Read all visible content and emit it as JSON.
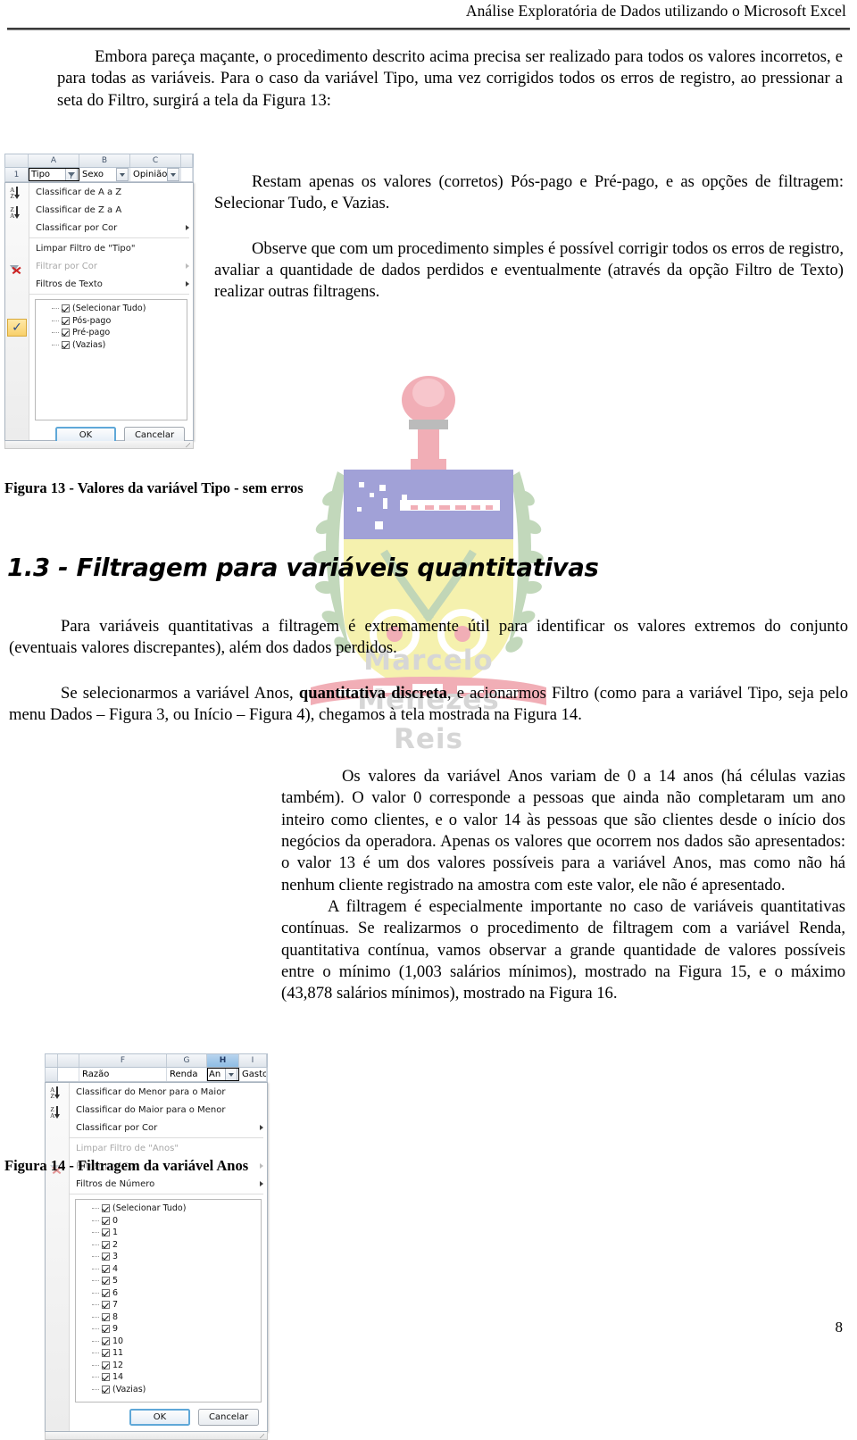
{
  "header": {
    "title": "Análise Exploratória de Dados utilizando o Microsoft Excel"
  },
  "watermark": {
    "name_line1": "Marcelo",
    "name_line2": "Menezes",
    "name_line3": "Reis",
    "colors": {
      "shield_top": "#9a9ad4",
      "shield_bottom": "#f5f0a8",
      "torch": "#f0a8b0",
      "laurel": "#a8c8a0",
      "text": "#d6d6d6"
    }
  },
  "paragraphs": {
    "p1": "Embora pareça maçante, o procedimento descrito acima precisa ser realizado para todos os valores incorretos, e para todas as variáveis. Para o caso da variável Tipo, uma vez corrigidos todos os erros de registro, ao pressionar a seta do Filtro, surgirá a tela da Figura 13:",
    "p2": "Restam apenas os valores (corretos) Pós-pago e Pré-pago, e as opções de filtragem: Selecionar Tudo, e Vazias.",
    "p3": "Observe que com um procedimento simples é possível corrigir todos os erros de registro, avaliar a quantidade de dados perdidos e eventualmente (através da opção Filtro de Texto) realizar outras filtragens.",
    "p4": "Para variáveis quantitativas a filtragem é extremamente útil para identificar os valores extremos do conjunto (eventuais valores discrepantes), além dos dados perdidos.",
    "p5_a": "Se selecionarmos a variável Anos, ",
    "p5_b": "quantitativa discreta",
    "p5_c": ", e acionarmos Filtro (como para a variável Tipo, seja pelo menu Dados – Figura 3, ou Início – Figura 4), chegamos à tela mostrada na Figura 14.",
    "p6": "Os valores da variável Anos variam de 0 a 14 anos (há células vazias também). O valor 0 corresponde a pessoas que ainda não completaram um ano inteiro como clientes, e o valor 14 às pessoas que são clientes desde o início dos negócios da operadora. Apenas os valores que ocorrem nos dados são apresentados: o valor 13 é um dos valores possíveis para a variável Anos, mas como não há nenhum cliente registrado na amostra com este valor, ele não é apresentado.",
    "p7": "A filtragem é especialmente importante no caso de variáveis quantitativas contínuas. Se realizarmos o procedimento de filtragem com a variável Renda, quantitativa contínua, vamos observar a grande quantidade de valores possíveis entre o mínimo (1,003 salários mínimos), mostrado na Figura 15, e o máximo (43,878 salários mínimos), mostrado na Figura 16."
  },
  "section_heading": "1.3 - Filtragem para variáveis quantitativas",
  "captions": {
    "figura13": "Figura 13 - Valores da variável Tipo - sem erros",
    "figura14": "Figura 14 - Filtragem da variável Anos"
  },
  "figura13_dialog": {
    "columns": [
      "A",
      "B",
      "C"
    ],
    "row_number": "1",
    "cells": [
      "Tipo",
      "Sexo",
      "Opinião"
    ],
    "menu_items": [
      {
        "label": "Classificar de A a Z",
        "dim": false,
        "submenu": false
      },
      {
        "label": "Classificar de Z a A",
        "dim": false,
        "submenu": false
      },
      {
        "label": "Classificar por Cor",
        "dim": false,
        "submenu": true
      },
      {
        "label": "Limpar Filtro de \"Tipo\"",
        "dim": false,
        "submenu": false
      },
      {
        "label": "Filtrar por Cor",
        "dim": true,
        "submenu": true
      },
      {
        "label": "Filtros de Texto",
        "dim": false,
        "submenu": true
      }
    ],
    "values": [
      "(Selecionar Tudo)",
      "Pós-pago",
      "Pré-pago",
      "(Vazias)"
    ],
    "buttons": {
      "ok": "OK",
      "cancel": "Cancelar"
    }
  },
  "figura14_dialog": {
    "columns": [
      "F",
      "G",
      "H",
      "I"
    ],
    "cells": [
      "Razão",
      "Renda",
      "An",
      "Gasto"
    ],
    "selected_column": "H",
    "menu_items": [
      {
        "label": "Classificar do Menor para o Maior",
        "dim": false,
        "submenu": false
      },
      {
        "label": "Classificar do Maior para o Menor",
        "dim": false,
        "submenu": false
      },
      {
        "label": "Classificar por Cor",
        "dim": false,
        "submenu": true
      },
      {
        "label": "Limpar Filtro de \"Anos\"",
        "dim": true,
        "submenu": false
      },
      {
        "label": "Filtrar por Cor",
        "dim": true,
        "submenu": true
      },
      {
        "label": "Filtros de Número",
        "dim": false,
        "submenu": true
      }
    ],
    "values": [
      "(Selecionar Tudo)",
      "0",
      "1",
      "2",
      "3",
      "4",
      "5",
      "6",
      "7",
      "8",
      "9",
      "10",
      "11",
      "12",
      "14",
      "(Vazias)"
    ],
    "buttons": {
      "ok": "OK",
      "cancel": "Cancelar"
    }
  },
  "page_number": "8"
}
